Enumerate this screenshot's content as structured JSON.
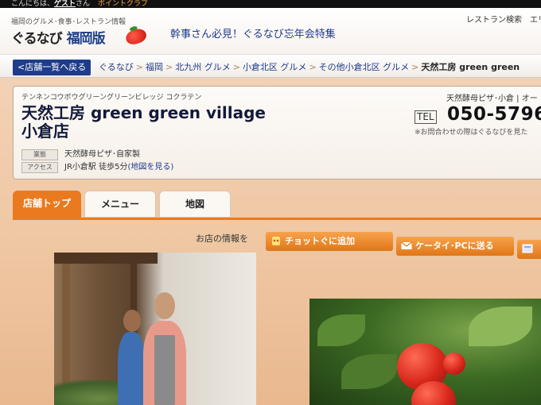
{
  "topbar": {
    "greeting": "こんにちは、",
    "user": "ゲスト",
    "honorific": "さん",
    "link": "ポイントクラブ"
  },
  "header": {
    "tagline": "福岡のグルメ･食事･レストラン情報",
    "logo_main": "ぐるなび",
    "logo_region": "福岡版",
    "promo": "幹事さん必見！ぐるなび忘年会特集",
    "links": [
      "レストラン検索",
      "エリ"
    ]
  },
  "breadcrumb": {
    "back_label": "店舗一覧へ戻る",
    "items": [
      "ぐるなび",
      "福岡",
      "北九州 グルメ",
      "小倉北区 グルメ",
      "その他小倉北区 グルメ"
    ],
    "current": "天然工房 green green",
    "separator": ">"
  },
  "shop": {
    "kana": "テンネンコウボウグリーングリーンビレッジ コクラテン",
    "name_line1": "天然工房 green green village",
    "name_line2": "小倉店",
    "genre_label": "業態",
    "genre_value": "天然酵母ピザ･自家製",
    "access_label": "アクセス",
    "access_value": "JR小倉駅 徒歩5分",
    "map_link": "(地図を見る)",
    "right_genre": "天然酵母ピザ･小倉 | オー",
    "tel_label": "TEL",
    "tel_number": "050-5796",
    "tel_note": "※お問合わせの際はぐるなびを見た"
  },
  "tabs": [
    "店舗トップ",
    "メニュー",
    "地図"
  ],
  "actions": {
    "store_info_label": "お店の情報を",
    "add_label": "チョットぐに追加",
    "send_label": "ケータイ･PCに送る"
  },
  "colors": {
    "accent": "#ea7a1f",
    "brand_blue": "#1f3c8a",
    "background": "#efc7a3"
  }
}
